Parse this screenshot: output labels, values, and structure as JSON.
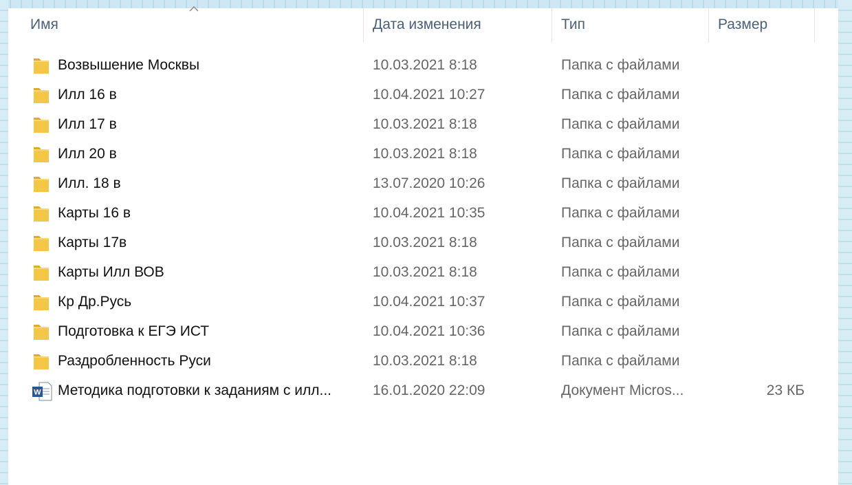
{
  "columns": {
    "name": "Имя",
    "date": "Дата изменения",
    "type": "Тип",
    "size": "Размер"
  },
  "sort": {
    "column": "name",
    "direction": "ascending",
    "icon": "chevron-up-icon"
  },
  "files": [
    {
      "icon": "folder-icon",
      "name": "Возвышение Москвы",
      "date": "10.03.2021 8:18",
      "type": "Папка с файлами",
      "size": ""
    },
    {
      "icon": "folder-icon",
      "name": "Илл 16 в",
      "date": "10.04.2021 10:27",
      "type": "Папка с файлами",
      "size": ""
    },
    {
      "icon": "folder-icon",
      "name": "Илл 17 в",
      "date": "10.03.2021 8:18",
      "type": "Папка с файлами",
      "size": ""
    },
    {
      "icon": "folder-icon",
      "name": "Илл 20 в",
      "date": "10.03.2021 8:18",
      "type": "Папка с файлами",
      "size": ""
    },
    {
      "icon": "folder-icon",
      "name": "Илл. 18 в",
      "date": "13.07.2020 10:26",
      "type": "Папка с файлами",
      "size": ""
    },
    {
      "icon": "folder-icon",
      "name": "Карты 16 в",
      "date": "10.04.2021 10:35",
      "type": "Папка с файлами",
      "size": ""
    },
    {
      "icon": "folder-icon",
      "name": "Карты 17в",
      "date": "10.03.2021 8:18",
      "type": "Папка с файлами",
      "size": ""
    },
    {
      "icon": "folder-icon",
      "name": "Карты Илл ВОВ",
      "date": "10.03.2021 8:18",
      "type": "Папка с файлами",
      "size": ""
    },
    {
      "icon": "folder-icon",
      "name": "Кр Др.Русь",
      "date": "10.04.2021 10:37",
      "type": "Папка с файлами",
      "size": ""
    },
    {
      "icon": "folder-icon",
      "name": "Подготовка к ЕГЭ ИСТ",
      "date": "10.04.2021 10:36",
      "type": "Папка с файлами",
      "size": ""
    },
    {
      "icon": "folder-icon",
      "name": "Раздробленность Руси",
      "date": "10.03.2021 8:18",
      "type": "Папка с файлами",
      "size": ""
    },
    {
      "icon": "word-document-icon",
      "name": "Методика подготовки к заданиям с илл...",
      "date": "16.01.2020 22:09",
      "type": "Документ Micros...",
      "size": "23 КБ"
    }
  ],
  "colors": {
    "folder": "#f5c748",
    "folder_dark": "#e1ab2a",
    "word_blue": "#2b5797",
    "header_text": "#4a607a",
    "name_text": "#111111",
    "meta_text": "#666666"
  }
}
